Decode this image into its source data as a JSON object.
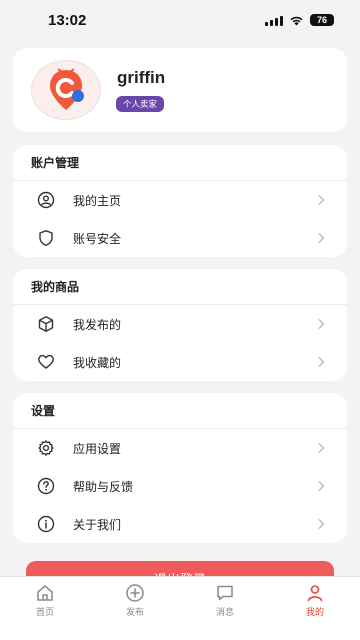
{
  "status_bar": {
    "time": "13:02",
    "battery": "76"
  },
  "profile": {
    "username": "griffin",
    "badge": "个人卖家"
  },
  "sections": [
    {
      "title": "账户管理",
      "items": [
        {
          "label": "我的主页",
          "icon": "user-circle-icon"
        },
        {
          "label": "账号安全",
          "icon": "shield-icon"
        }
      ]
    },
    {
      "title": "我的商品",
      "items": [
        {
          "label": "我发布的",
          "icon": "box-icon"
        },
        {
          "label": "我收藏的",
          "icon": "heart-icon"
        }
      ]
    },
    {
      "title": "设置",
      "items": [
        {
          "label": "应用设置",
          "icon": "gear-icon"
        },
        {
          "label": "帮助与反馈",
          "icon": "help-icon"
        },
        {
          "label": "关于我们",
          "icon": "info-icon"
        }
      ]
    }
  ],
  "logout_label": "退出登录",
  "tabs": [
    {
      "label": "首页",
      "icon": "home-icon",
      "active": false
    },
    {
      "label": "发布",
      "icon": "plus-circle-icon",
      "active": false
    },
    {
      "label": "消息",
      "icon": "message-icon",
      "active": false
    },
    {
      "label": "我的",
      "icon": "person-icon",
      "active": true
    }
  ],
  "colors": {
    "accent": "#e8453c",
    "badge": "#6a46a8",
    "logout": "#ef5b5b",
    "background": "#f3f3f5"
  }
}
